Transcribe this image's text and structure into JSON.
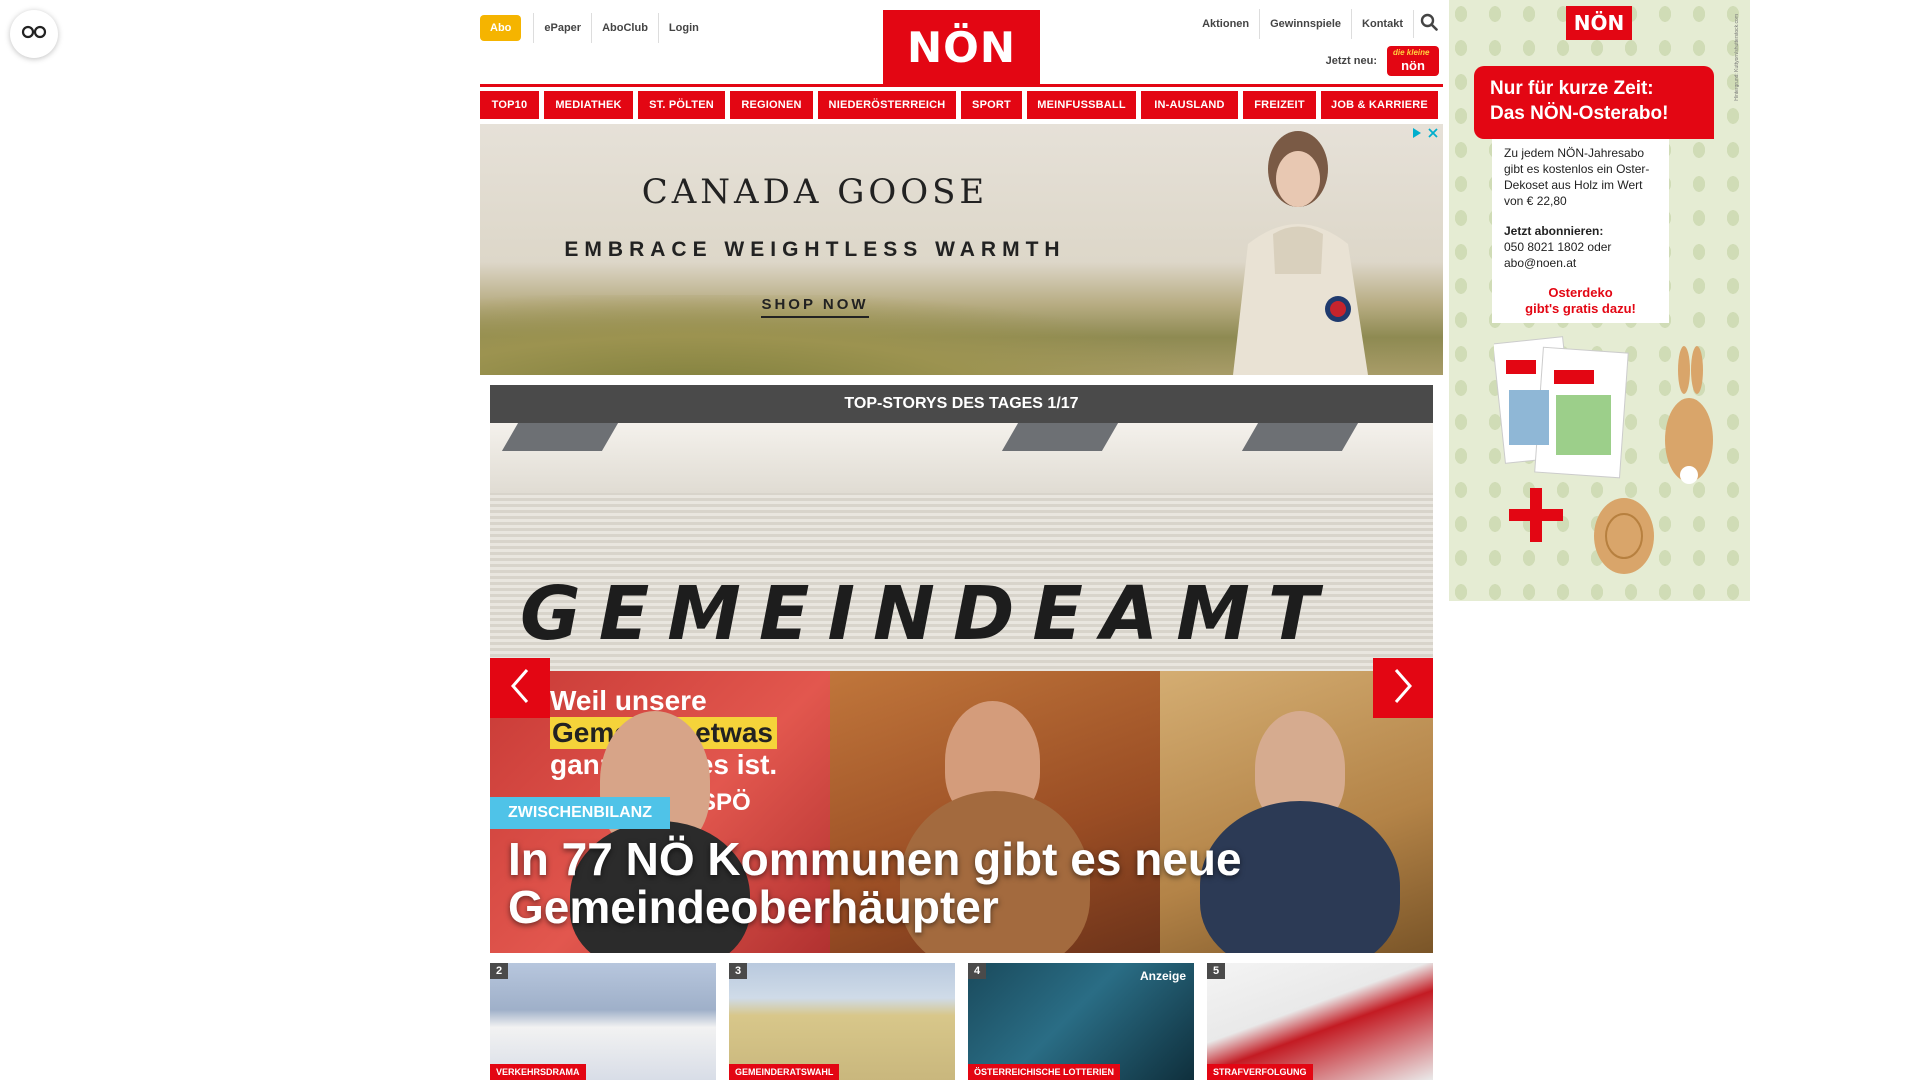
{
  "accessibility": {
    "icon": "glasses-icon"
  },
  "header": {
    "util_left": {
      "abo": "Abo",
      "links": [
        "ePaper",
        "AboClub",
        "Login"
      ]
    },
    "logo": "NÖN",
    "util_right": {
      "links": [
        "Aktionen",
        "Gewinnspiele",
        "Kontakt"
      ],
      "search_icon": "search-icon"
    },
    "jetzt_neu": {
      "label": "Jetzt neu:",
      "logo_small": "die kleine",
      "logo_main": "nön"
    }
  },
  "nav": {
    "items": [
      "TOP10",
      "MEDIATHEK",
      "ST. PÖLTEN",
      "REGIONEN",
      "NIEDERÖSTERREICH",
      "SPORT",
      "MEINFUSSBALL",
      "IN-AUSLAND",
      "FREIZEIT",
      "JOB & KARRIERE"
    ],
    "accent": "#e30613"
  },
  "banner_ad": {
    "brand": "CANADA GOOSE",
    "tagline": "EMBRACE WEIGHTLESS WARMTH",
    "cta": "SHOP NOW"
  },
  "top_stories": {
    "header": "TOP-STORYS DES TAGES 1/17",
    "hero": {
      "sign": "GEMEINDEAMT",
      "poster_lines": [
        "Weil unsere",
        "Gemeinde etwas",
        "ganz anderes ist."
      ],
      "poster_logo": "SPÖ",
      "category": "ZWISCHENBILANZ",
      "title": "In 77 NÖ Kommunen gibt es neue Gemeindeoberhäupter"
    },
    "thumbnails": [
      {
        "number": "2",
        "category": "VERKEHRSDRAMA",
        "badge": ""
      },
      {
        "number": "3",
        "category": "GEMEINDERATSWAHL",
        "badge": ""
      },
      {
        "number": "4",
        "category": "ÖSTERREICHISCHE LOTTERIEN",
        "badge": "Anzeige"
      },
      {
        "number": "5",
        "category": "STRAFVERFOLGUNG",
        "badge": ""
      }
    ]
  },
  "side_ad": {
    "logo": "NÖN",
    "headline_1": "Nur für kurze Zeit:",
    "headline_2": "Das NÖN-Osterabo!",
    "body_1": "Zu jedem NÖN-Jahresabo gibt es kostenlos ein Oster-Dekoset aus Holz im Wert von € 22,80",
    "cta_label": "Jetzt abonnieren:",
    "contact": "050 8021 1802 oder abo@noen.at",
    "highlight_1": "Osterdeko",
    "highlight_2": "gibt's gratis dazu!",
    "credit": "Hintergrund: Kuttyorn/shutterstock.com"
  }
}
